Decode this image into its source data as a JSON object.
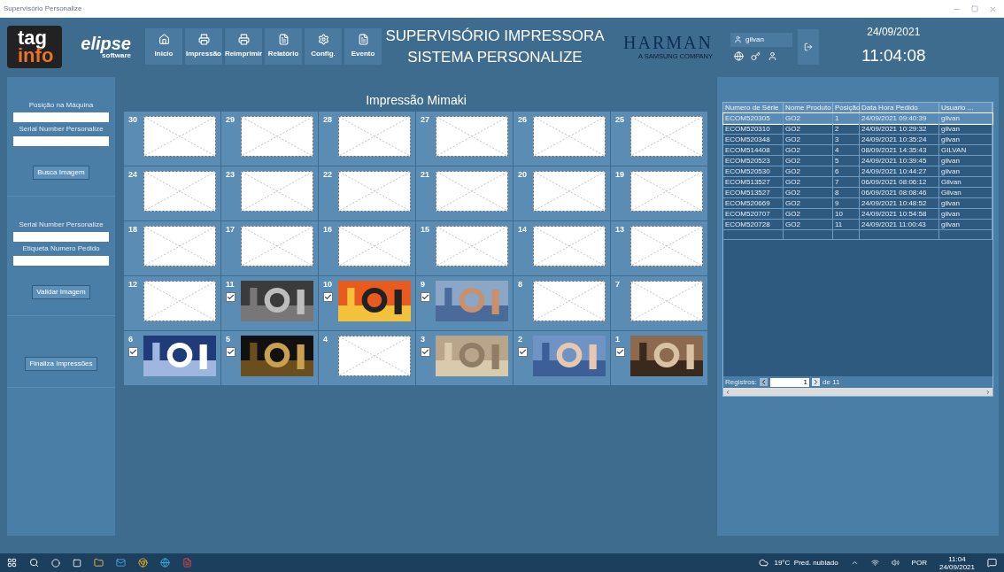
{
  "window": {
    "title": "Supervisório Personalize"
  },
  "header": {
    "logo": {
      "top": "tag",
      "bottom": "info"
    },
    "brand": {
      "name": "elipse",
      "sub": "software"
    },
    "nav": [
      {
        "label": "Inicio",
        "kind": "home"
      },
      {
        "label": "Impressão",
        "kind": "printer"
      },
      {
        "label": "Reimprimir",
        "kind": "printer"
      },
      {
        "label": "Relatório",
        "kind": "file"
      },
      {
        "label": "Config.",
        "kind": "gear"
      },
      {
        "label": "Evento",
        "kind": "file"
      }
    ],
    "title": [
      "SUPERVISÓRIO IMPRESSORA",
      "SISTEMA PERSONALIZE"
    ],
    "partner": {
      "name": "HARMAN",
      "sub": "A SAMSUNG COMPANY"
    },
    "user": "gilvan",
    "date": "24/09/2021",
    "time": "11:04:08"
  },
  "left_panel": {
    "sections": [
      {
        "fields": [
          {
            "label": "Posição na Máquina"
          },
          {
            "label": "Serial Number Personalize"
          }
        ],
        "button": "Busca Imagem"
      },
      {
        "fields": [
          {
            "label": "Serial Number Personalize"
          },
          {
            "label": "Etiqueta Numero Pedido"
          }
        ],
        "button": "Validar Imagem"
      },
      {
        "button": "Finaliza Impressões"
      }
    ]
  },
  "grid": {
    "title": "Impressão Mimaki",
    "tiles": [
      {
        "number": "30",
        "checked": false,
        "kind": "placeholder"
      },
      {
        "number": "29",
        "checked": false,
        "kind": "placeholder"
      },
      {
        "number": "28",
        "checked": false,
        "kind": "placeholder"
      },
      {
        "number": "27",
        "checked": false,
        "kind": "placeholder"
      },
      {
        "number": "26",
        "checked": false,
        "kind": "placeholder"
      },
      {
        "number": "25",
        "checked": false,
        "kind": "placeholder"
      },
      {
        "number": "24",
        "checked": false,
        "kind": "placeholder"
      },
      {
        "number": "23",
        "checked": false,
        "kind": "placeholder"
      },
      {
        "number": "22",
        "checked": false,
        "kind": "placeholder"
      },
      {
        "number": "21",
        "checked": false,
        "kind": "placeholder"
      },
      {
        "number": "20",
        "checked": false,
        "kind": "placeholder"
      },
      {
        "number": "19",
        "checked": false,
        "kind": "placeholder"
      },
      {
        "number": "18",
        "checked": false,
        "kind": "placeholder"
      },
      {
        "number": "17",
        "checked": false,
        "kind": "placeholder"
      },
      {
        "number": "16",
        "checked": false,
        "kind": "placeholder"
      },
      {
        "number": "15",
        "checked": false,
        "kind": "placeholder"
      },
      {
        "number": "14",
        "checked": false,
        "kind": "placeholder"
      },
      {
        "number": "13",
        "checked": false,
        "kind": "placeholder"
      },
      {
        "number": "12",
        "checked": false,
        "kind": "placeholder"
      },
      {
        "number": "11",
        "checked": true,
        "kind": "picture"
      },
      {
        "number": "10",
        "checked": true,
        "kind": "picture"
      },
      {
        "number": "9",
        "checked": true,
        "kind": "picture"
      },
      {
        "number": "8",
        "checked": false,
        "kind": "placeholder"
      },
      {
        "number": "7",
        "checked": false,
        "kind": "placeholder"
      },
      {
        "number": "6",
        "checked": true,
        "kind": "picture"
      },
      {
        "number": "5",
        "checked": true,
        "kind": "picture"
      },
      {
        "number": "4",
        "checked": false,
        "kind": "placeholder"
      },
      {
        "number": "3",
        "checked": true,
        "kind": "picture"
      },
      {
        "number": "2",
        "checked": true,
        "kind": "picture"
      },
      {
        "number": "1",
        "checked": true,
        "kind": "picture"
      }
    ]
  },
  "table": {
    "columns": [
      "Numero de Série",
      "Nome Produto",
      "Posição",
      "Data Hora Pedido",
      "Usuario ..."
    ],
    "rows": [
      {
        "selected": true,
        "cells": [
          "ECOM520305",
          "GO2",
          "1",
          "24/09/2021 09:40:39",
          "gilvan"
        ]
      },
      {
        "selected": false,
        "cells": [
          "ECOM520310",
          "GO2",
          "2",
          "24/09/2021 10:29:32",
          "gilvan"
        ]
      },
      {
        "selected": false,
        "cells": [
          "ECOM520348",
          "GO2",
          "3",
          "24/09/2021 10:35:24",
          "gilvan"
        ]
      },
      {
        "selected": false,
        "cells": [
          "ECOM514408",
          "GO2",
          "4",
          "08/09/2021 14:35:43",
          "GILVAN"
        ]
      },
      {
        "selected": false,
        "cells": [
          "ECOM520523",
          "GO2",
          "5",
          "24/09/2021 10:39:45",
          "gilvan"
        ]
      },
      {
        "selected": false,
        "cells": [
          "ECOM520530",
          "GO2",
          "6",
          "24/09/2021 10:44:27",
          "gilvan"
        ]
      },
      {
        "selected": false,
        "cells": [
          "ECOM513527",
          "GO2",
          "7",
          "06/09/2021 08:06:12",
          "Gilvan"
        ]
      },
      {
        "selected": false,
        "cells": [
          "ECOM513527",
          "GO2",
          "8",
          "06/09/2021 08:08:46",
          "Gilvan"
        ]
      },
      {
        "selected": false,
        "cells": [
          "ECOM520669",
          "GO2",
          "9",
          "24/09/2021 10:48:52",
          "gilvan"
        ]
      },
      {
        "selected": false,
        "cells": [
          "ECOM520707",
          "GO2",
          "10",
          "24/09/2021 10:54:58",
          "gilvan"
        ]
      },
      {
        "selected": false,
        "cells": [
          "ECOM520728",
          "GO2",
          "11",
          "24/09/2021 11:00:43",
          "gilvan"
        ]
      }
    ],
    "pager": {
      "label": "Registros:",
      "value": "1",
      "total": "de 11"
    }
  },
  "taskbar": {
    "weather": "19°C  Pred. nublado",
    "language": "POR",
    "time": "11:04",
    "date": "24/09/2021"
  }
}
